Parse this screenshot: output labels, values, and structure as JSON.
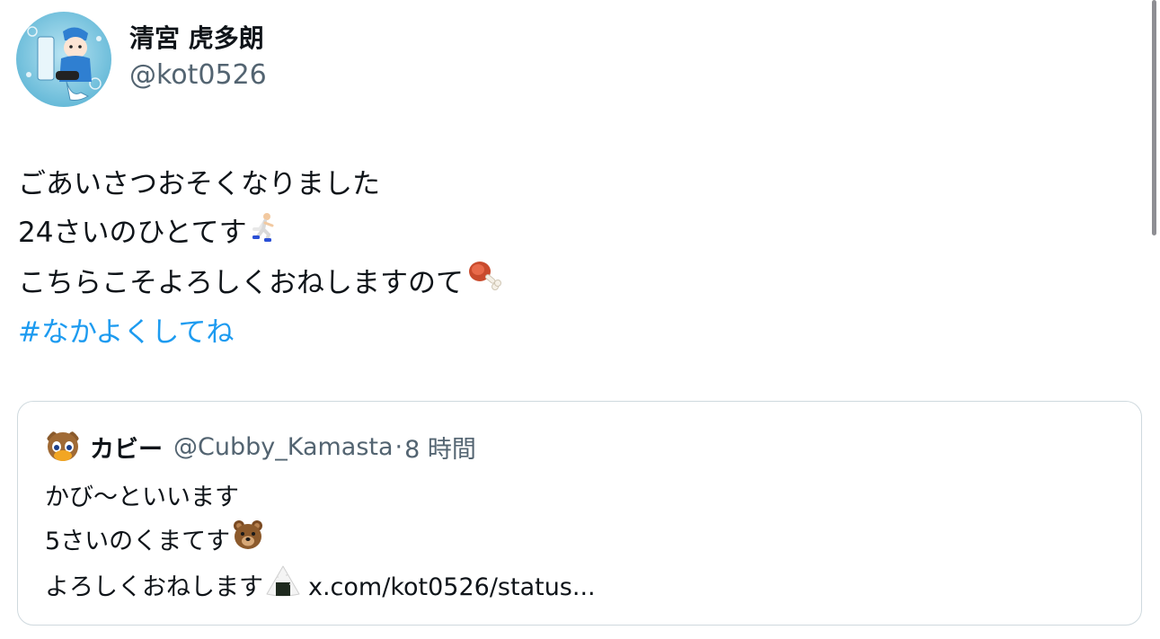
{
  "tweet": {
    "author": {
      "display_name": "清宮 虎多朗",
      "handle": "@kot0526",
      "avatar_icon": "avatar-baseball-illustration"
    },
    "lines": [
      {
        "text": "ごあいさつおそくなりました",
        "emoji": ""
      },
      {
        "text": "24さいのひとてす",
        "emoji": "person-running-icon"
      },
      {
        "text": "こちらこそよろしくおねしますのて",
        "emoji": "meat-on-bone-icon"
      }
    ],
    "hashtag": "#なかよくしてね",
    "colors": {
      "link": "#1d9bf0",
      "secondary": "#536471",
      "border": "#cfd9de"
    }
  },
  "quote": {
    "author": {
      "display_name": "カビー",
      "handle": "@Cubby_Kamasta",
      "separator": "·",
      "time": "8 時間",
      "avatar_icon": "bear-mascot-avatar"
    },
    "lines": [
      {
        "text": "かび〜といいます",
        "emoji": ""
      },
      {
        "text": "5さいのくまてす",
        "emoji": "bear-face-icon"
      },
      {
        "text": "よろしくおねします",
        "emoji": "rice-ball-icon"
      }
    ],
    "link": "x.com/kot0526/status..."
  }
}
